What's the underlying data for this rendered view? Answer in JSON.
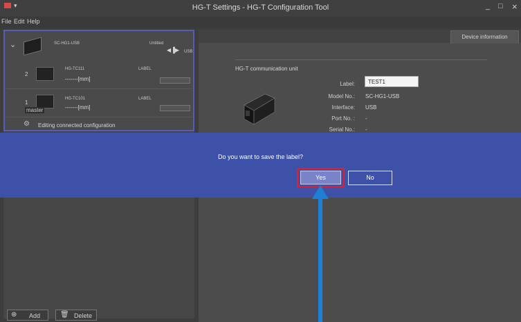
{
  "window": {
    "title": "HG-T Settings - HG-T Configuration Tool",
    "minimize": "_",
    "maximize": "□",
    "close": "×"
  },
  "menu": {
    "file": "File",
    "edit": "Edit",
    "help": "Help"
  },
  "tree": {
    "controller": {
      "model": "SC-HG1-USB",
      "label": "Untitled",
      "interface": "USB"
    },
    "units": [
      {
        "number": "2",
        "model": "HG-TC111",
        "label_header": "LABEL",
        "value": "-------[mm]"
      },
      {
        "number": "1",
        "model": "HG-TC101",
        "label_header": "LABEL",
        "value": "-------[mm]",
        "badge": "master"
      }
    ],
    "status": "Editing connected configuration"
  },
  "buttons": {
    "add": "Add",
    "delete": "Delete"
  },
  "right": {
    "tab": "Device information",
    "section": "HG-T communication unit",
    "fields": [
      {
        "label": "Label:",
        "value": "TEST1"
      },
      {
        "label": "Model No.:",
        "value": "SC-HG1-USB"
      },
      {
        "label": "Interface:",
        "value": "USB"
      },
      {
        "label": "Port No. :",
        "value": "-"
      },
      {
        "label": "Serial No.:",
        "value": "-"
      }
    ]
  },
  "dialog": {
    "message": "Do you want to save the label?",
    "yes": "Yes",
    "no": "No"
  },
  "colors": {
    "overlay": "#3e51a8",
    "highlight": "#e0202e",
    "arrow": "#1e7fd6"
  }
}
